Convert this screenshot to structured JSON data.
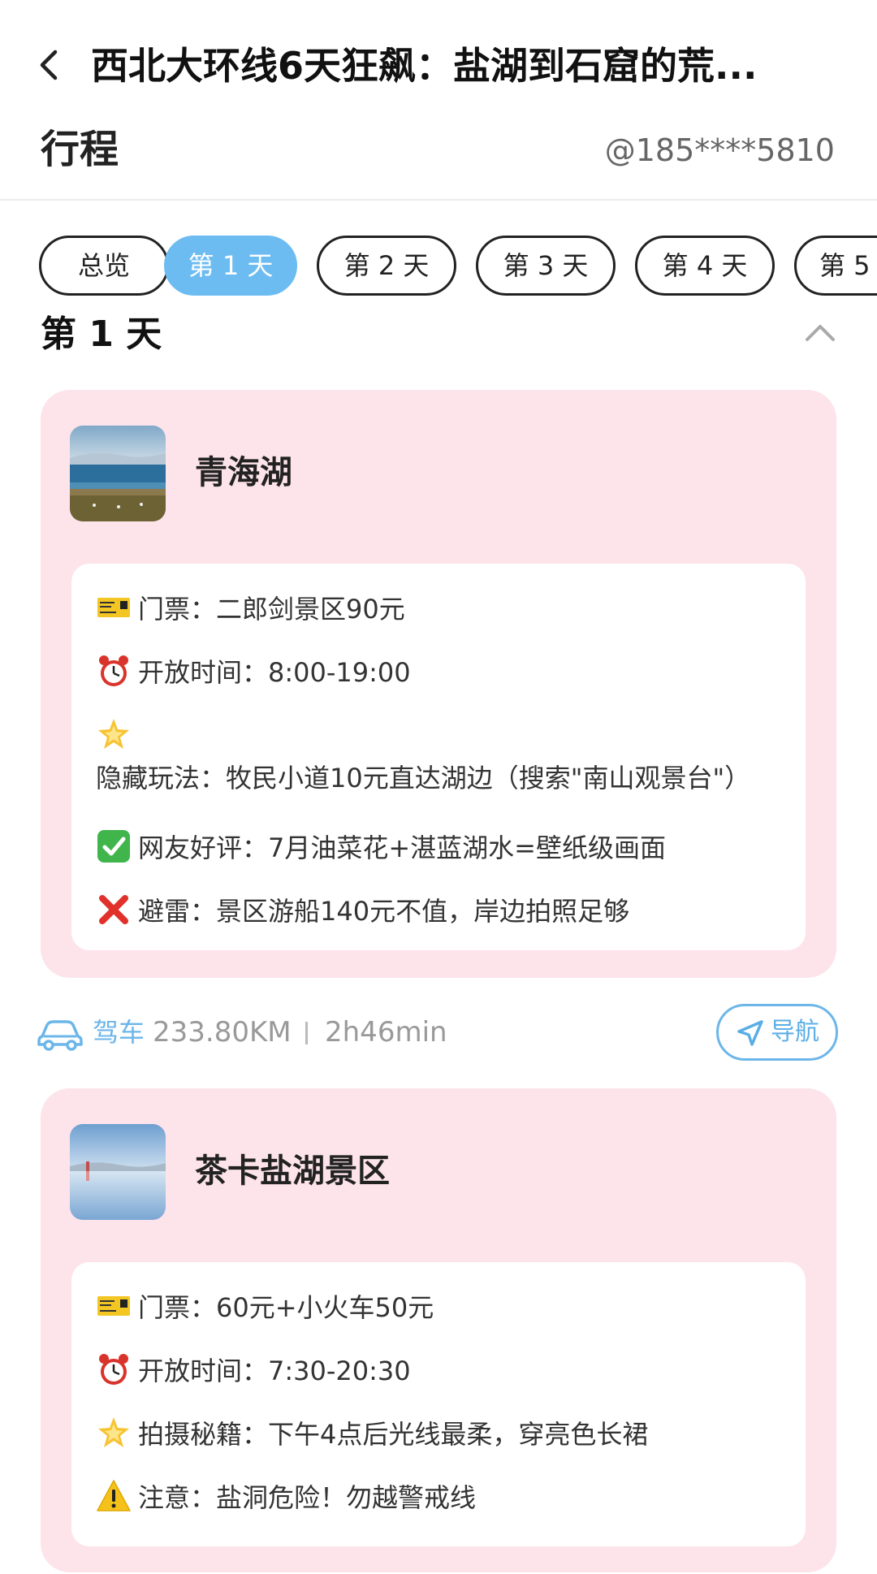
{
  "header": {
    "title": "西北大环线6天狂飙：盐湖到石窟的荒...",
    "subtitle": "行程",
    "account": "@185****5810"
  },
  "tabs": [
    {
      "label": "总览",
      "active": false
    },
    {
      "label": "第 1 天",
      "active": true
    },
    {
      "label": "第 2 天",
      "active": false
    },
    {
      "label": "第 3 天",
      "active": false
    },
    {
      "label": "第 4 天",
      "active": false
    },
    {
      "label": "第 5",
      "active": false
    }
  ],
  "day_heading": "第 1 天",
  "spots": [
    {
      "name": "青海湖",
      "rows": [
        {
          "icon": "ticket-icon",
          "text": "门票：二郎剑景区90元"
        },
        {
          "icon": "alarm-clock-icon",
          "text": "开放时间：8:00-19:00"
        },
        {
          "icon": "sparkle-star-icon",
          "text": "隐藏玩法：牧民小道10元直达湖边（搜索\"南山观景台\"）"
        },
        {
          "icon": "check-mark-icon",
          "text": "网友好评：7月油菜花+湛蓝湖水=壁纸级画面"
        },
        {
          "icon": "cross-mark-icon",
          "text": "避雷：景区游船140元不值，岸边拍照足够"
        }
      ]
    },
    {
      "name": "茶卡盐湖景区",
      "rows": [
        {
          "icon": "ticket-icon",
          "text": "门票：60元+小火车50元"
        },
        {
          "icon": "alarm-clock-icon",
          "text": "开放时间：7:30-20:30"
        },
        {
          "icon": "sparkle-star-icon",
          "text": "拍摄秘籍：下午4点后光线最柔，穿亮色长裙"
        },
        {
          "icon": "warning-icon",
          "text": "注意：盐洞危险！勿越警戒线"
        }
      ]
    }
  ],
  "drive": {
    "label": "驾车",
    "distance": "233.80KM",
    "duration": "2h46min",
    "nav_label": "导航"
  },
  "colors": {
    "accent": "#6cbcf2",
    "card_bg": "#fde3ea",
    "drive_blue": "#6cb6ea"
  }
}
